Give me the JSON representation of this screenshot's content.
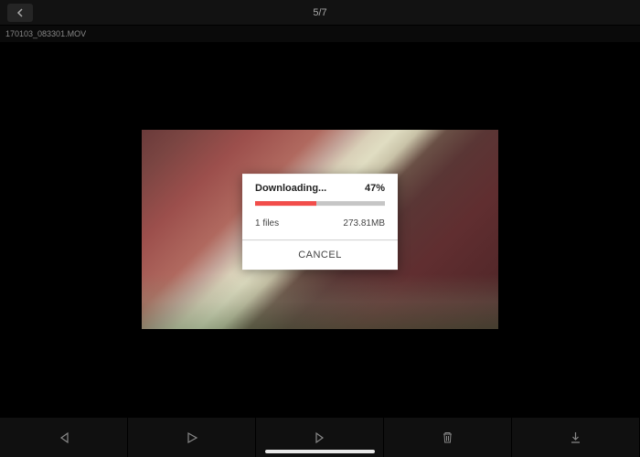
{
  "header": {
    "counter": "5/7",
    "filename": "170103_083301.MOV"
  },
  "dialog": {
    "label": "Downloading...",
    "percent_text": "47%",
    "progress_percent": 47,
    "files_text": "1 files",
    "size_text": "273.81MB",
    "cancel_label": "CANCEL"
  },
  "colors": {
    "progress_fill": "#f24d4a"
  }
}
